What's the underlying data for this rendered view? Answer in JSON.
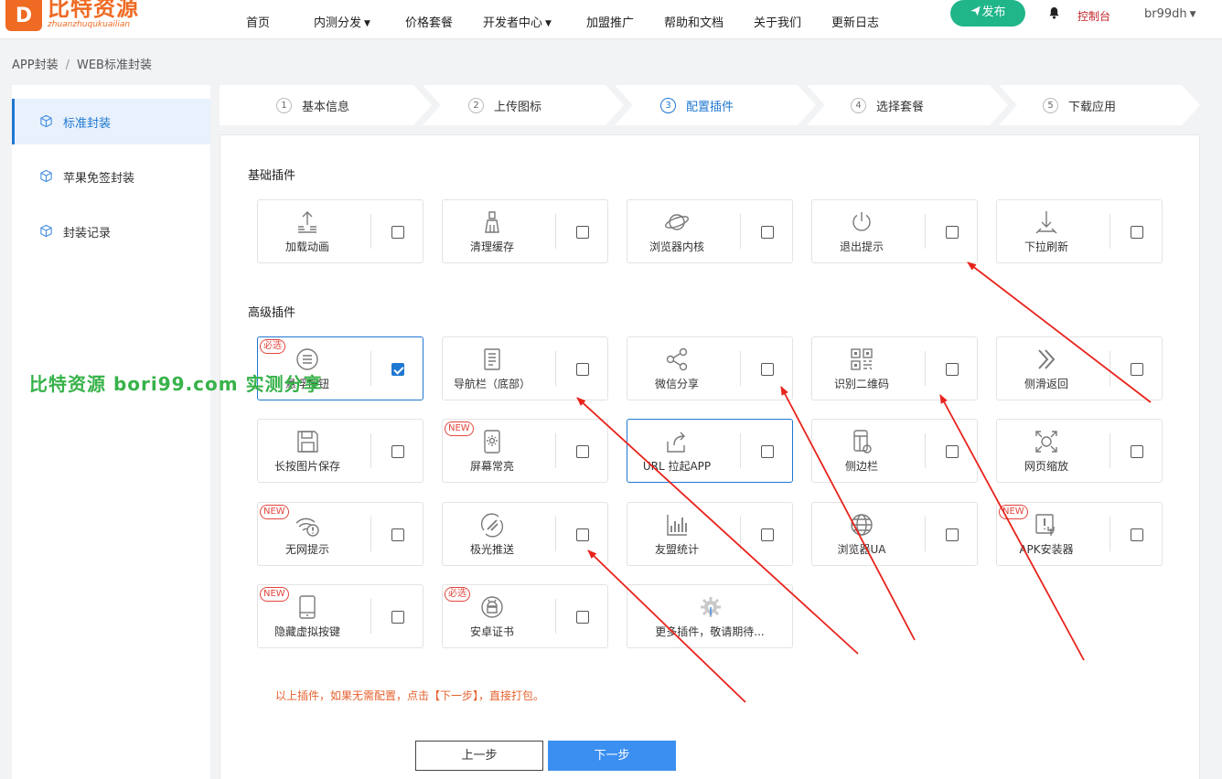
{
  "header": {
    "logo_mark": "D",
    "logo_title": "比特资源",
    "logo_subtitle": "zhuanzhuqukuailian",
    "nav": [
      {
        "label": "首页",
        "dropdown": false
      },
      {
        "label": "内测分发",
        "dropdown": true
      },
      {
        "label": "价格套餐",
        "dropdown": false
      },
      {
        "label": "开发者中心",
        "dropdown": true
      },
      {
        "label": "加盟推广",
        "dropdown": false
      },
      {
        "label": "帮助和文档",
        "dropdown": false
      },
      {
        "label": "关于我们",
        "dropdown": false
      },
      {
        "label": "更新日志",
        "dropdown": false
      }
    ],
    "publish_label": "发布",
    "console_label": "控制台",
    "username": "br99dh"
  },
  "breadcrumb": [
    "APP封装",
    "WEB标准封装"
  ],
  "sidebar": {
    "items": [
      {
        "label": "标准封装",
        "active": true
      },
      {
        "label": "苹果免签封装",
        "active": false
      },
      {
        "label": "封装记录",
        "active": false
      }
    ]
  },
  "steps": [
    {
      "num": "1",
      "label": "基本信息",
      "active": false
    },
    {
      "num": "2",
      "label": "上传图标",
      "active": false
    },
    {
      "num": "3",
      "label": "配置插件",
      "active": true
    },
    {
      "num": "4",
      "label": "选择套餐",
      "active": false
    },
    {
      "num": "5",
      "label": "下载应用",
      "active": false
    }
  ],
  "basic_title": "基础插件",
  "basic_plugins": [
    {
      "label": "加载动画",
      "icon": "upload-lines-icon",
      "checked": false
    },
    {
      "label": "清理缓存",
      "icon": "broom-icon",
      "checked": false
    },
    {
      "label": "浏览器内核",
      "icon": "planet-icon",
      "checked": false
    },
    {
      "label": "退出提示",
      "icon": "power-icon",
      "checked": false
    },
    {
      "label": "下拉刷新",
      "icon": "pull-down-icon",
      "checked": false
    }
  ],
  "advanced_title": "高级插件",
  "advanced_plugins": [
    {
      "label": "悬浮按钮",
      "icon": "menu-circle-icon",
      "checked": true,
      "tag": "必选",
      "highlight": true
    },
    {
      "label": "导航栏（底部）",
      "icon": "document-icon",
      "checked": false
    },
    {
      "label": "微信分享",
      "icon": "share-icon",
      "checked": false
    },
    {
      "label": "识别二维码",
      "icon": "qrcode-icon",
      "checked": false
    },
    {
      "label": "侧滑返回",
      "icon": "double-chevron-icon",
      "checked": false
    },
    {
      "label": "长按图片保存",
      "icon": "floppy-icon",
      "checked": false
    },
    {
      "label": "屏幕常亮",
      "icon": "phone-sun-icon",
      "checked": false,
      "tag": "NEW"
    },
    {
      "label": "URL 拉起APP",
      "icon": "external-link-icon",
      "checked": false,
      "highlight": true
    },
    {
      "label": "侧边栏",
      "icon": "sidebar-icon",
      "checked": false
    },
    {
      "label": "网页缩放",
      "icon": "zoom-icon",
      "checked": false
    },
    {
      "label": "无网提示",
      "icon": "wifi-alert-icon",
      "checked": false,
      "tag": "NEW"
    },
    {
      "label": "极光推送",
      "icon": "aurora-icon",
      "checked": false
    },
    {
      "label": "友盟统计",
      "icon": "bar-chart-icon",
      "checked": false
    },
    {
      "label": "浏览器UA",
      "icon": "globe-icon",
      "checked": false
    },
    {
      "label": "APK安装器",
      "icon": "apk-tool-icon",
      "checked": false,
      "tag": "NEW"
    },
    {
      "label": "隐藏虚拟按键",
      "icon": "mobile-icon",
      "checked": false,
      "tag": "NEW"
    },
    {
      "label": "安卓证书",
      "icon": "android-icon",
      "checked": false,
      "tag": "必选"
    },
    {
      "label": "更多插件，敬请期待...",
      "icon": "gear-icon",
      "more": true
    }
  ],
  "note": "以上插件，如果无需配置，点击【下一步】，直接打包。",
  "buttons": {
    "prev": "上一步",
    "next": "下一步"
  },
  "watermark": "比特资源 bori99.com 实测分享",
  "colors": {
    "brand": "#ef6a22",
    "primary": "#1f78d1",
    "publish": "#21b58a",
    "arrow": "#e8231c",
    "watermark": "#37b24a"
  }
}
